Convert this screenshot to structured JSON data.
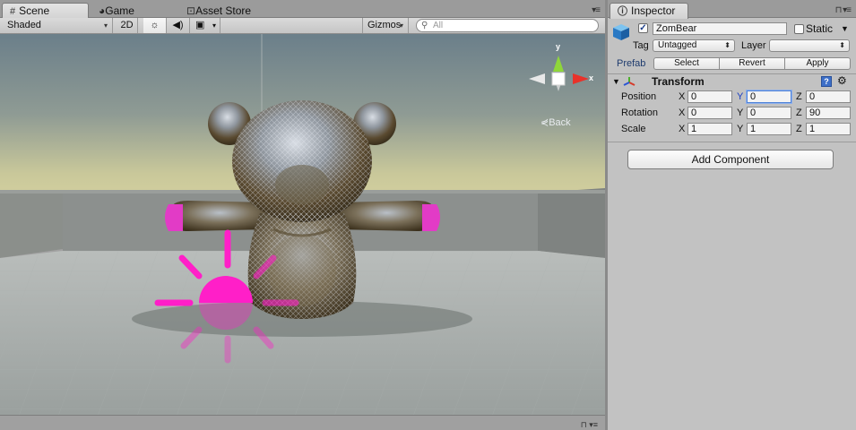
{
  "scene_tabs": {
    "scene": "Scene",
    "game": "Game",
    "asset_store": "Asset Store"
  },
  "scene_toolbar": {
    "shading_mode": "Shaded",
    "mode_2d": "2D",
    "gizmos": "Gizmos",
    "search_placeholder": "All"
  },
  "viewport": {
    "gizmo_axis_y": "y",
    "gizmo_axis_x": "x",
    "back_label": "Back"
  },
  "inspector": {
    "tab_label": "Inspector",
    "object_name": "ZomBear",
    "object_active": true,
    "static_label": "Static",
    "static_checked": false,
    "tag_label": "Tag",
    "tag_value": "Untagged",
    "layer_label": "Layer",
    "layer_value": "",
    "prefab_label": "Prefab",
    "prefab_buttons": [
      "Select",
      "Revert",
      "Apply"
    ],
    "transform": {
      "title": "Transform",
      "rows": [
        {
          "label": "Position",
          "x": "0",
          "y": "0",
          "z": "0"
        },
        {
          "label": "Rotation",
          "x": "0",
          "y": "0",
          "z": "90"
        },
        {
          "label": "Scale",
          "x": "1",
          "y": "1",
          "z": "1"
        }
      ],
      "axis_labels": [
        "X",
        "Y",
        "Z"
      ]
    },
    "add_component": "Add Component"
  },
  "colors": {
    "accent_blue": "#4e82d8",
    "magenta_light": "#ff1fc8",
    "panel_bg": "#c2c2c2"
  }
}
